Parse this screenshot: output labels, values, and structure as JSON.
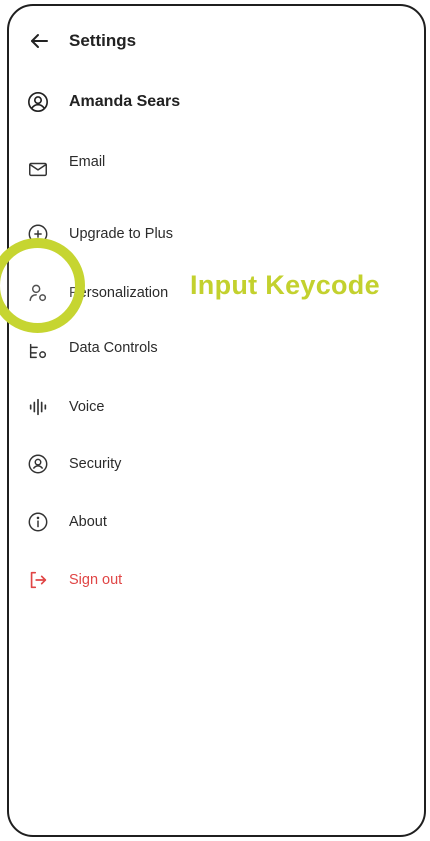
{
  "header": {
    "title": "Settings",
    "back_icon": "arrow-left-icon"
  },
  "profile": {
    "name": "Amanda Sears",
    "icon": "user-circle-icon"
  },
  "menu": {
    "email": {
      "label": "Email",
      "icon": "mail-icon"
    },
    "upgrade": {
      "label": "Upgrade to Plus",
      "icon": "plus-circle-icon"
    },
    "personalization": {
      "label": "Personalization",
      "icon": "user-settings-icon"
    },
    "data_controls": {
      "label": "Data Controls",
      "icon": "data-controls-icon"
    },
    "voice": {
      "label": "Voice",
      "icon": "waveform-icon"
    },
    "security": {
      "label": "Security",
      "icon": "security-icon"
    },
    "about": {
      "label": "About",
      "icon": "info-icon"
    },
    "sign_out": {
      "label": "Sign out",
      "icon": "logout-icon"
    }
  },
  "annotation": {
    "text": "Input Keycode",
    "color": "#c3d12e"
  },
  "colors": {
    "danger": "#e04545",
    "text": "#2b2b2b"
  }
}
